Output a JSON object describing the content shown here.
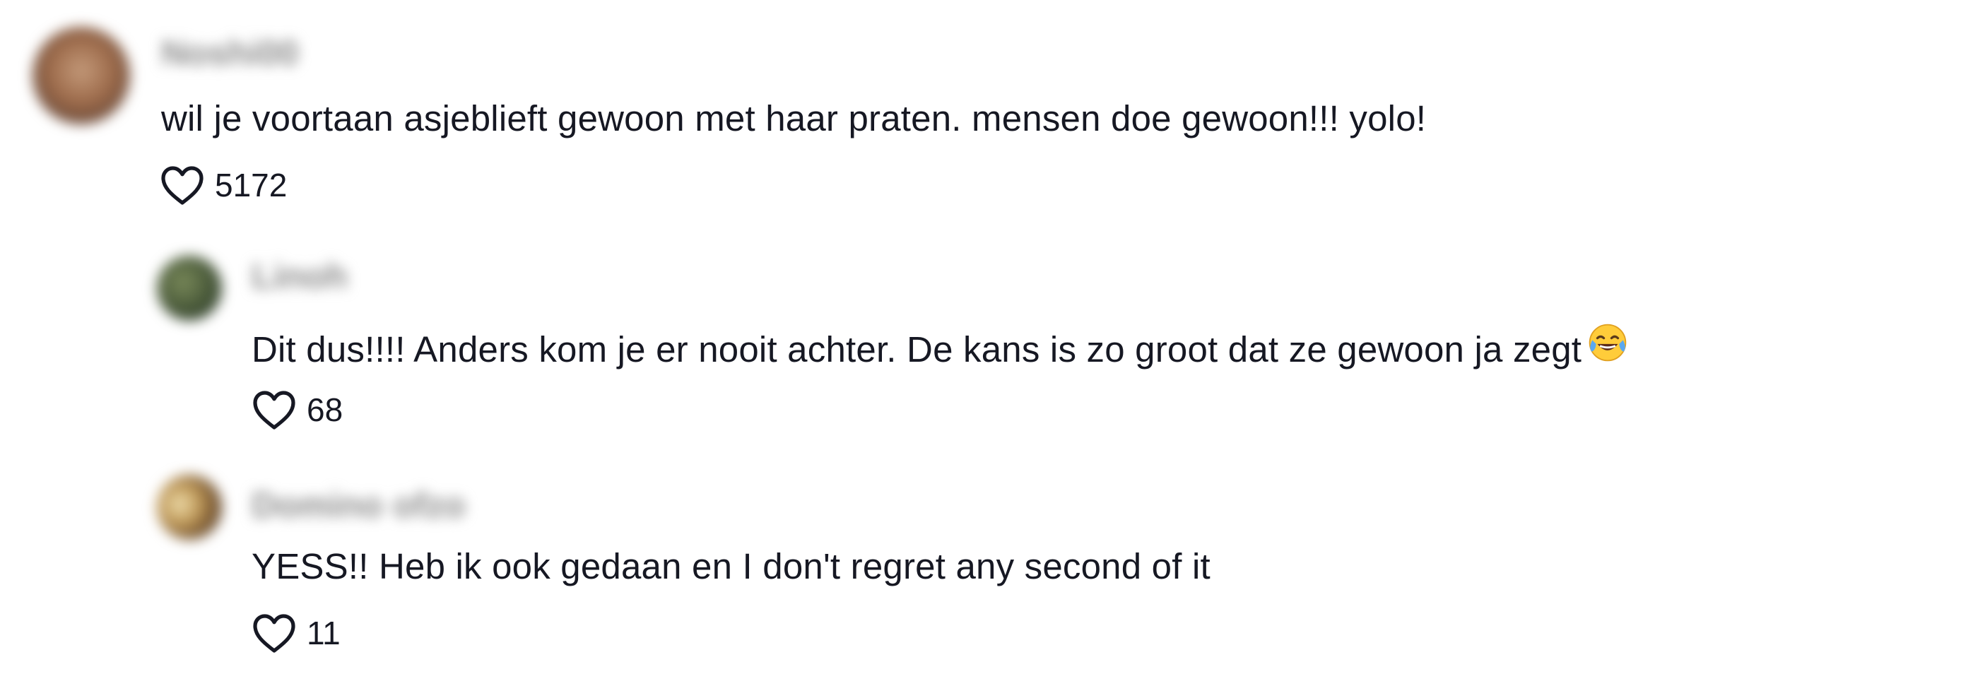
{
  "comments": [
    {
      "username": "Noshi00",
      "text": "wil je voortaan asjeblieft gewoon met haar praten. mensen doe gewoon!!! yolo!",
      "likes": "5172",
      "avatar_color": "#9c6a4a"
    },
    {
      "username": "Linoh",
      "text": "Dit dus!!!! Anders kom je er nooit achter. De kans is zo groot dat ze gewoon ja zegt",
      "emoji": "face-with-tears-of-joy",
      "likes": "68",
      "avatar_color": "#4a5a3a"
    },
    {
      "username": "Domino ofzo",
      "text": "YESS!! Heb ik ook gedaan en I don't regret any second of it",
      "likes": "11",
      "avatar_color": "#8a6a3a"
    }
  ],
  "icons": {
    "like": "heart-outline-icon"
  },
  "colors": {
    "text": "#161823",
    "background": "#ffffff"
  }
}
